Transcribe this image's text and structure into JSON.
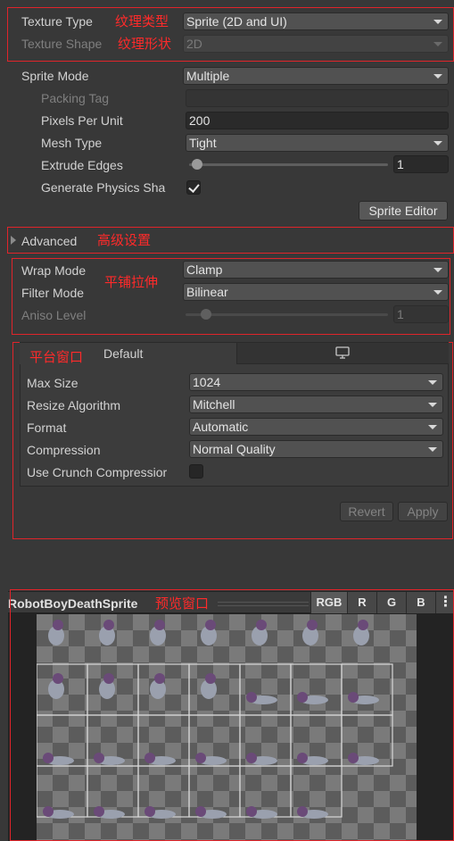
{
  "texture": {
    "type_label": "Texture Type",
    "type_value": "Sprite (2D and UI)",
    "type_anno": "纹理类型",
    "shape_label": "Texture Shape",
    "shape_value": "2D",
    "shape_anno": "纹理形状"
  },
  "sprite": {
    "mode_label": "Sprite Mode",
    "mode_value": "Multiple",
    "packing_tag_label": "Packing Tag",
    "packing_tag_value": "",
    "ppu_label": "Pixels Per Unit",
    "ppu_value": "200",
    "mesh_type_label": "Mesh Type",
    "mesh_type_value": "Tight",
    "extrude_label": "Extrude Edges",
    "extrude_value": "1",
    "extrude_level": 0.04,
    "physics_label": "Generate Physics Sha",
    "physics_checked": true,
    "editor_button": "Sprite Editor"
  },
  "advanced": {
    "label": "Advanced",
    "anno": "高级设置"
  },
  "wrap": {
    "wrap_label": "Wrap Mode",
    "wrap_value": "Clamp",
    "filter_label": "Filter Mode",
    "filter_value": "Bilinear",
    "aniso_label": "Aniso Level",
    "aniso_value": "1",
    "aniso_level": 0.1,
    "anno": "平铺拉伸"
  },
  "platform": {
    "anno": "平台窗口",
    "tab_default": "Default",
    "tab_icon": "monitor-icon",
    "max_size_label": "Max Size",
    "max_size_value": "1024",
    "resize_label": "Resize Algorithm",
    "resize_value": "Mitchell",
    "format_label": "Format",
    "format_value": "Automatic",
    "compression_label": "Compression",
    "compression_value": "Normal Quality",
    "crunch_label": "Use Crunch Compressior",
    "crunch_checked": false,
    "revert_button": "Revert",
    "apply_button": "Apply"
  },
  "preview": {
    "title": "RobotBoyDeathSprite",
    "anno": "预览窗口",
    "channels": [
      "RGB",
      "R",
      "G",
      "B"
    ],
    "menu_icon": "kebab-menu-icon"
  },
  "colors": {
    "annotation": "#ff2a2a",
    "panel_bg": "#383838",
    "field_bg": "#515151"
  }
}
